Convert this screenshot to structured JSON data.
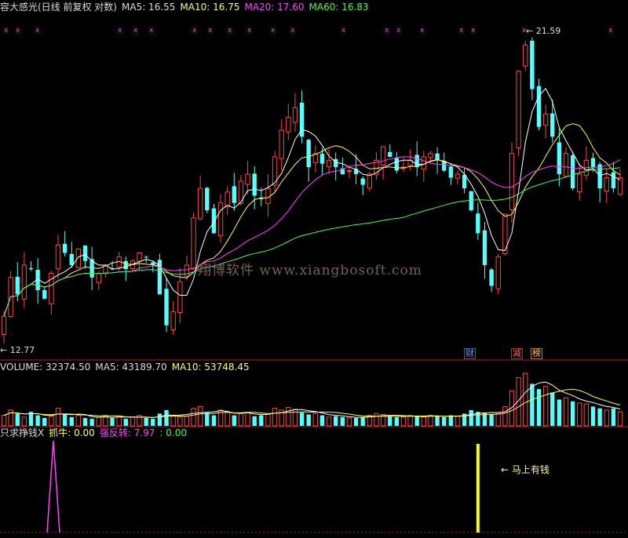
{
  "header": {
    "title": "容大感光(日线 前复权 对数)",
    "ma5": "MA5: 16.55",
    "ma10": "MA10: 16.75",
    "ma20": "MA20: 17.60",
    "ma60": "MA60: 16.83"
  },
  "volume_header": {
    "volume": "VOLUME: 32374.50",
    "ma5": "MA5: 43189.70",
    "ma10": "MA10: 53748.45"
  },
  "indicator_header": {
    "name": "只求挣钱X",
    "zhuaniu": "抓牛: 0.00",
    "qiangfanzhuan": "强反转: 7.97",
    "third": ": 0.00"
  },
  "watermark": "翔博软件 www.xiangbosoft.com",
  "tags": {
    "cai": "财",
    "jian": "减",
    "bang": "榜"
  },
  "labels": {
    "high": "21.59",
    "low": "12.77",
    "signal": "马上有钱"
  },
  "colors": {
    "up": "#ff4444",
    "down": "#55ffff",
    "ma5": "#ffffff",
    "ma10": "#ffff44",
    "ma20": "#ff44ff",
    "ma60": "#44ff44",
    "signal": "#ffff00"
  },
  "chart_data": [
    {
      "type": "candlestick",
      "title": "容大感光(日线 前复权 对数)",
      "y_scale": "log",
      "price_high": 21.59,
      "price_low": 12.77,
      "closes": [
        13.4,
        14.3,
        13.9,
        14.6,
        14.5,
        14.0,
        13.8,
        14.4,
        15.1,
        14.9,
        14.6,
        15.0,
        14.7,
        14.3,
        14.4,
        14.6,
        14.5,
        14.8,
        14.5,
        14.7,
        14.9,
        14.8,
        14.6,
        13.9,
        13.2,
        13.5,
        14.2,
        14.6,
        15.8,
        16.6,
        16.0,
        15.4,
        16.2,
        16.5,
        16.2,
        16.8,
        17.0,
        16.4,
        16.3,
        16.6,
        17.5,
        18.3,
        18.7,
        19.0,
        18.1,
        17.2,
        17.6,
        17.3,
        17.4,
        17.2,
        17.0,
        17.1,
        17.0,
        16.7,
        17.0,
        17.4,
        17.8,
        17.5,
        17.1,
        17.2,
        17.4,
        17.2,
        17.5,
        17.6,
        17.4,
        17.1,
        16.9,
        17.0,
        16.6,
        16.0,
        15.4,
        14.6,
        14.1,
        14.8,
        15.9,
        17.6,
        20.2,
        21.1,
        19.6,
        18.4,
        18.8,
        18.1,
        17.0,
        17.6,
        16.6,
        17.0,
        17.4,
        17.2,
        16.6,
        16.9,
        16.6,
        16.9
      ],
      "ma_lines": [
        "MA5",
        "MA10",
        "MA20",
        "MA60"
      ],
      "ma_values_last": {
        "MA5": 16.55,
        "MA10": 16.75,
        "MA20": 17.6,
        "MA60": 16.83
      }
    },
    {
      "type": "bar",
      "title": "VOLUME",
      "volume_last": 32374.5,
      "ma5_last": 43189.7,
      "ma10_last": 53748.45,
      "values": [
        12,
        18,
        14,
        10,
        16,
        12,
        9,
        11,
        20,
        14,
        10,
        12,
        9,
        8,
        10,
        12,
        9,
        11,
        8,
        10,
        12,
        9,
        8,
        14,
        18,
        12,
        10,
        11,
        20,
        22,
        15,
        12,
        18,
        16,
        12,
        14,
        15,
        11,
        12,
        14,
        20,
        18,
        21,
        19,
        15,
        13,
        14,
        12,
        10,
        11,
        10,
        9,
        9,
        10,
        12,
        14,
        13,
        11,
        10,
        10,
        12,
        11,
        10,
        12,
        11,
        10,
        12,
        11,
        14,
        18,
        16,
        15,
        13,
        14,
        22,
        40,
        55,
        60,
        48,
        42,
        45,
        38,
        30,
        32,
        28,
        26,
        25,
        22,
        20,
        18,
        20,
        16
      ]
    },
    {
      "type": "line",
      "title": "只求挣钱X",
      "zhuaniu": 0.0,
      "qiangfanzhuan": 7.97,
      "signal_index": 70
    }
  ]
}
